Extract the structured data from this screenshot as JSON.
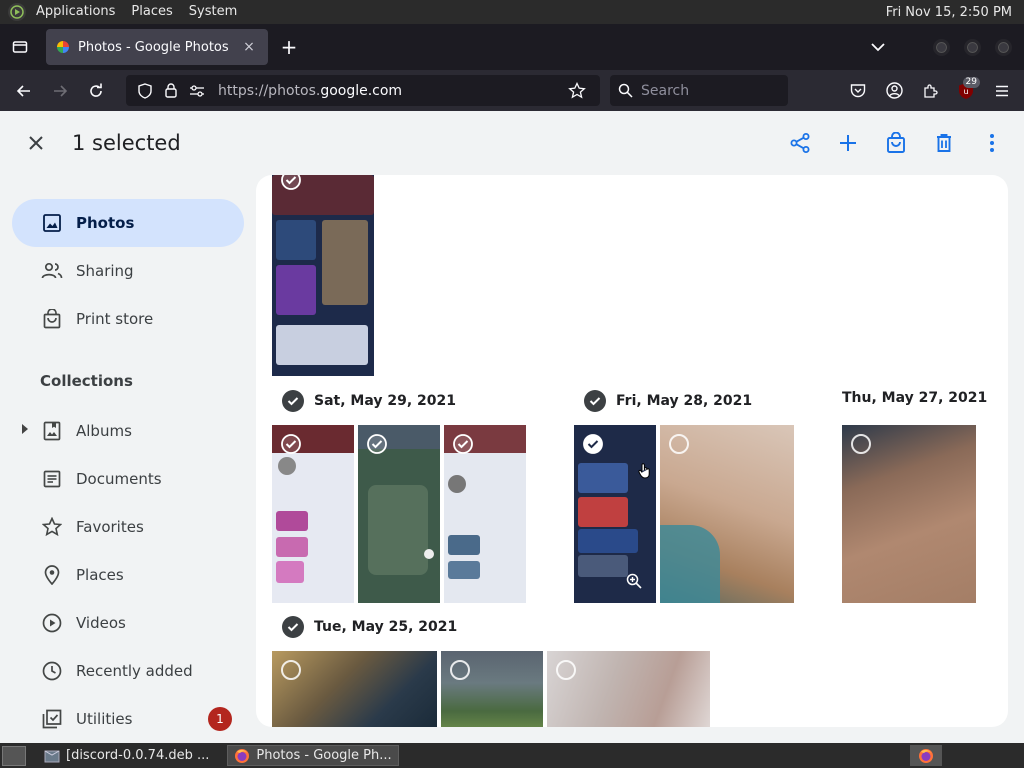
{
  "top_panel": {
    "menus": [
      "Applications",
      "Places",
      "System"
    ],
    "clock": "Fri Nov 15,  2:50 PM"
  },
  "browser": {
    "tab": {
      "title": "Photos - Google Photos",
      "close": "×"
    },
    "new_tab": "+",
    "url_prefix": "https://photos.",
    "url_domain": "google.com",
    "search_placeholder": "Search",
    "extension_badge": "29"
  },
  "page": {
    "selection_title": "1 selected",
    "actions": [
      "share-icon",
      "add-icon",
      "order-prints-icon",
      "delete-icon",
      "more-icon"
    ],
    "sidebar": {
      "primary": [
        {
          "label": "Photos",
          "icon": "photos-icon",
          "active": true
        },
        {
          "label": "Sharing",
          "icon": "sharing-icon"
        },
        {
          "label": "Print store",
          "icon": "print-store-icon"
        }
      ],
      "section_title": "Collections",
      "collections": [
        {
          "label": "Albums",
          "icon": "albums-icon"
        },
        {
          "label": "Documents",
          "icon": "documents-icon"
        },
        {
          "label": "Favorites",
          "icon": "star-icon"
        },
        {
          "label": "Places",
          "icon": "place-icon"
        },
        {
          "label": "Videos",
          "icon": "video-icon"
        },
        {
          "label": "Recently added",
          "icon": "clock-icon"
        },
        {
          "label": "Utilities",
          "icon": "utilities-icon",
          "badge": "1"
        }
      ]
    },
    "date_groups": [
      {
        "date": "Sat, May 29, 2021",
        "selected": true
      },
      {
        "date": "Fri, May 28, 2021",
        "selected": true
      },
      {
        "date": "Thu, May 27, 2021",
        "selected": false
      },
      {
        "date": "Tue, May 25, 2021",
        "selected": true
      }
    ]
  },
  "taskbar": {
    "items": [
      {
        "label": "[discord-0.0.74.deb ...",
        "active": false
      },
      {
        "label": "Photos - Google Ph...",
        "active": true
      }
    ]
  },
  "colors": {
    "accent": "#1a73e8",
    "active_nav": "#d3e3fd",
    "badge": "#b3261e"
  }
}
